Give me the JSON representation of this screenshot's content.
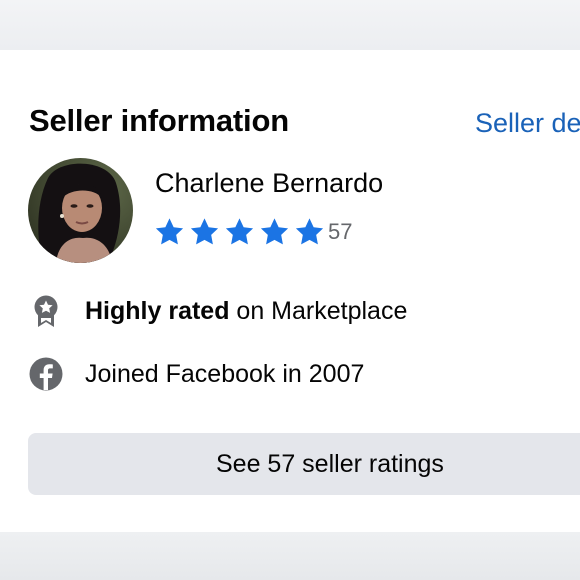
{
  "section": {
    "title": "Seller information",
    "details_link": "Seller de"
  },
  "seller": {
    "name": "Charlene Bernardo",
    "rating_stars": 5,
    "rating_count": "57"
  },
  "badges": [
    {
      "bold": "Highly rated",
      "text": " on Marketplace",
      "icon": "award-badge-icon"
    },
    {
      "text": "Joined Facebook in 2007",
      "icon": "facebook-icon"
    }
  ],
  "ratings_button": {
    "label": "See 57 seller ratings"
  },
  "colors": {
    "star": "#1b74e4",
    "link": "#1a62b8",
    "icon": "#65676b",
    "button_bg": "#e4e6eb"
  }
}
